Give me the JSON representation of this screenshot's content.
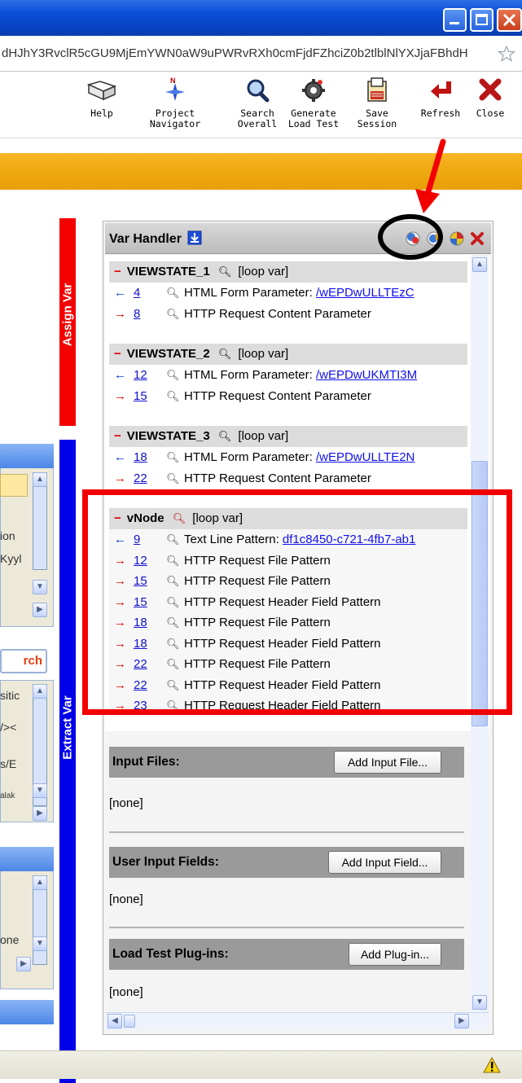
{
  "address_bar": {
    "url_fragment": "dHJhY3RvclR5cGU9MjEmYWN0aW9uPWRvRXh0cmFjdFZhciZ0b2tlblNlYXJjaFBhdH"
  },
  "toolbar": {
    "items": [
      {
        "id": "help",
        "label_line1": "Help",
        "label_line2": "",
        "icon": "book-icon"
      },
      {
        "id": "project-navigator",
        "label_line1": "Project",
        "label_line2": "Navigator",
        "icon": "compass-icon"
      },
      {
        "id": "search-overall",
        "label_line1": "Search",
        "label_line2": "Overall",
        "icon": "magnifier-icon"
      },
      {
        "id": "generate-load-test",
        "label_line1": "Generate",
        "label_line2": "Load Test",
        "icon": "gear-icon"
      },
      {
        "id": "save-session",
        "label_line1": "Save",
        "label_line2": "Session",
        "icon": "save-icon"
      },
      {
        "id": "refresh",
        "label_line1": "Refresh",
        "label_line2": "",
        "icon": "refresh-arrow-icon"
      },
      {
        "id": "close",
        "label_line1": "Close",
        "label_line2": "",
        "icon": "close-x-icon"
      }
    ]
  },
  "side_tabs": {
    "assign": "Assign Var",
    "extract": "Extract Var"
  },
  "left_panel": {
    "text1": "ion",
    "text2": "Kyyl",
    "search_btn": "rch",
    "text3": "sitic",
    "text4": "/><",
    "text5": "s/E",
    "text6": "alak",
    "text7": "one"
  },
  "var_handler": {
    "title": "Var Handler",
    "groups": [
      {
        "name": "VIEWSTATE_1",
        "tag": "[loop var]",
        "rows": [
          {
            "dir": "left",
            "step": "4",
            "desc": "HTML Form Parameter: ",
            "link": "/wEPDwULLTEzC"
          },
          {
            "dir": "right",
            "step": "8",
            "desc": "HTTP Request Content Parameter",
            "link": ""
          }
        ]
      },
      {
        "name": "VIEWSTATE_2",
        "tag": "[loop var]",
        "rows": [
          {
            "dir": "left",
            "step": "12",
            "desc": "HTML Form Parameter: ",
            "link": "/wEPDwUKMTI3M"
          },
          {
            "dir": "right",
            "step": "15",
            "desc": "HTTP Request Content Parameter",
            "link": ""
          }
        ]
      },
      {
        "name": "VIEWSTATE_3",
        "tag": "[loop var]",
        "rows": [
          {
            "dir": "left",
            "step": "18",
            "desc": "HTML Form Parameter: ",
            "link": "/wEPDwULLTE2N"
          },
          {
            "dir": "right",
            "step": "22",
            "desc": "HTTP Request Content Parameter",
            "link": ""
          }
        ]
      },
      {
        "name": "vNode",
        "tag": "[loop var]",
        "rows": [
          {
            "dir": "left",
            "step": "9",
            "desc": "Text Line Pattern: ",
            "link": "df1c8450-c721-4fb7-ab1"
          },
          {
            "dir": "right",
            "step": "12",
            "desc": "HTTP Request File Pattern",
            "link": ""
          },
          {
            "dir": "right",
            "step": "15",
            "desc": "HTTP Request File Pattern",
            "link": ""
          },
          {
            "dir": "right",
            "step": "15",
            "desc": "HTTP Request Header Field Pattern",
            "link": ""
          },
          {
            "dir": "right",
            "step": "18",
            "desc": "HTTP Request File Pattern",
            "link": ""
          },
          {
            "dir": "right",
            "step": "18",
            "desc": "HTTP Request Header Field Pattern",
            "link": ""
          },
          {
            "dir": "right",
            "step": "22",
            "desc": "HTTP Request File Pattern",
            "link": ""
          },
          {
            "dir": "right",
            "step": "22",
            "desc": "HTTP Request Header Field Pattern",
            "link": ""
          },
          {
            "dir": "right",
            "step": "23",
            "desc": "HTTP Request Header Field Pattern",
            "link": ""
          }
        ]
      }
    ]
  },
  "sections": {
    "input_files": {
      "title": "Input Files:",
      "button": "Add Input File...",
      "value": "[none]"
    },
    "user_input_fields": {
      "title": "User Input Fields:",
      "button": "Add Input Field...",
      "value": "[none]"
    },
    "load_test_plugins": {
      "title": "Load Test Plug-ins:",
      "button": "Add Plug-in...",
      "value": "[none]"
    }
  },
  "colors": {
    "assign_tab": "#f30000",
    "extract_tab": "#0000e8",
    "annotation_box": "#f20000",
    "annotation_circle": "#000000",
    "orange_band": "#eea90f"
  }
}
